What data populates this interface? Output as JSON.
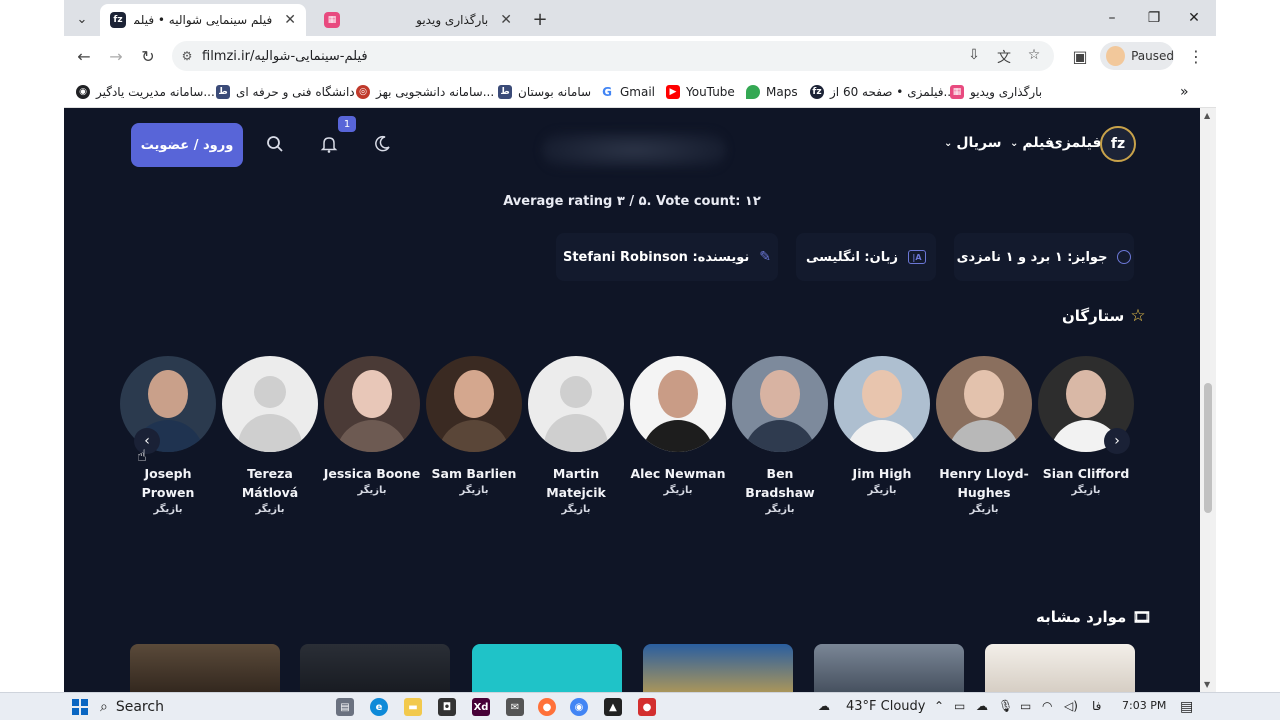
{
  "browser": {
    "tabs": [
      {
        "title": "فیلم سینمایی شوالیه • فیلمزی",
        "favicon": "fz",
        "active": true
      },
      {
        "title": "بارگذاری ویدیو",
        "favicon": "grid",
        "active": false
      }
    ],
    "url": "filmzi.ir/فیلم-سینمایی-شوالیه",
    "profile_label": "Paused",
    "bookmarks": [
      {
        "label": "بارگذاری ویدیو",
        "icon": "grid-icon"
      },
      {
        "label": "فیلمزی • صفحه 60 از...",
        "icon": "fz-icon"
      },
      {
        "label": "Maps",
        "icon": "maps-icon"
      },
      {
        "label": "YouTube",
        "icon": "youtube-icon"
      },
      {
        "label": "Gmail",
        "icon": "google-icon"
      },
      {
        "label": "سامانه بوستان",
        "icon": "site-icon"
      },
      {
        "label": "سامانه دانشجویی بهز...",
        "icon": "site-icon"
      },
      {
        "label": "دانشگاه فنی و حرفه ای",
        "icon": "site-icon"
      },
      {
        "label": "سامانه مدیریت یادگیر...",
        "icon": "globe-icon"
      }
    ]
  },
  "header": {
    "logo_text": "فیلمزی",
    "logo_mark": "fz",
    "nav": [
      {
        "label": "فیلم"
      },
      {
        "label": "سریال"
      }
    ],
    "login_label": "ورود / عضویت",
    "notification_count": "1"
  },
  "movie": {
    "rating_text": "Average rating ۳ / ۵. Vote count: ۱۲",
    "info": [
      {
        "text": "جوایز: ۱ برد و ۱ نامزدی",
        "icon": "award-icon"
      },
      {
        "text": "زبان: انگلیسی",
        "icon": "language-icon"
      },
      {
        "text": "نویسنده: Stefani Robinson",
        "icon": "pencil-icon"
      }
    ]
  },
  "cast": {
    "title": "ستارگان",
    "role_label": "بازیگر",
    "actors": [
      {
        "name": "Sian Clifford",
        "photo": true
      },
      {
        "name": "Henry Lloyd-Hughes",
        "photo": true
      },
      {
        "name": "Jim High",
        "photo": true
      },
      {
        "name": "Ben Bradshaw",
        "photo": true
      },
      {
        "name": "Alec Newman",
        "photo": true
      },
      {
        "name": "Martin Matejcik",
        "photo": false
      },
      {
        "name": "Sam Barlien",
        "photo": true
      },
      {
        "name": "Jessica Boone",
        "photo": true
      },
      {
        "name": "Tereza Mátlová",
        "photo": false
      },
      {
        "name": "Joseph Prowen",
        "photo": true
      }
    ]
  },
  "similar": {
    "title": "موارد مشابه"
  },
  "taskbar": {
    "search_label": "Search",
    "weather": "43°F  Cloudy",
    "lang": "فا",
    "time": "7:03 PM"
  }
}
